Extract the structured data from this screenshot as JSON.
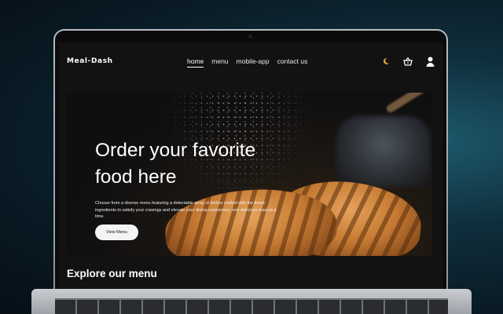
{
  "site": {
    "logo": "Meal-Dash"
  },
  "nav": {
    "links": [
      {
        "label": "home",
        "active": true
      },
      {
        "label": "menu",
        "active": false
      },
      {
        "label": "mobile-app",
        "active": false
      },
      {
        "label": "contact us",
        "active": false
      }
    ],
    "icons": [
      "moon-icon",
      "basket-icon",
      "user-icon"
    ]
  },
  "hero": {
    "title_line1": "Order your favorite",
    "title_line2": "food here",
    "description": "Choose from a diverse menu featuring a delectable array of dishes crafted with the finest ingredients to satisfy your cravings and elevate your dining experience, one delicious meal at a time.",
    "button_label": "View Menu"
  },
  "section": {
    "title": "Explore our menu"
  },
  "colors": {
    "accent_moon": "#e0a33a",
    "background": "#121212",
    "text": "#ffffff"
  }
}
